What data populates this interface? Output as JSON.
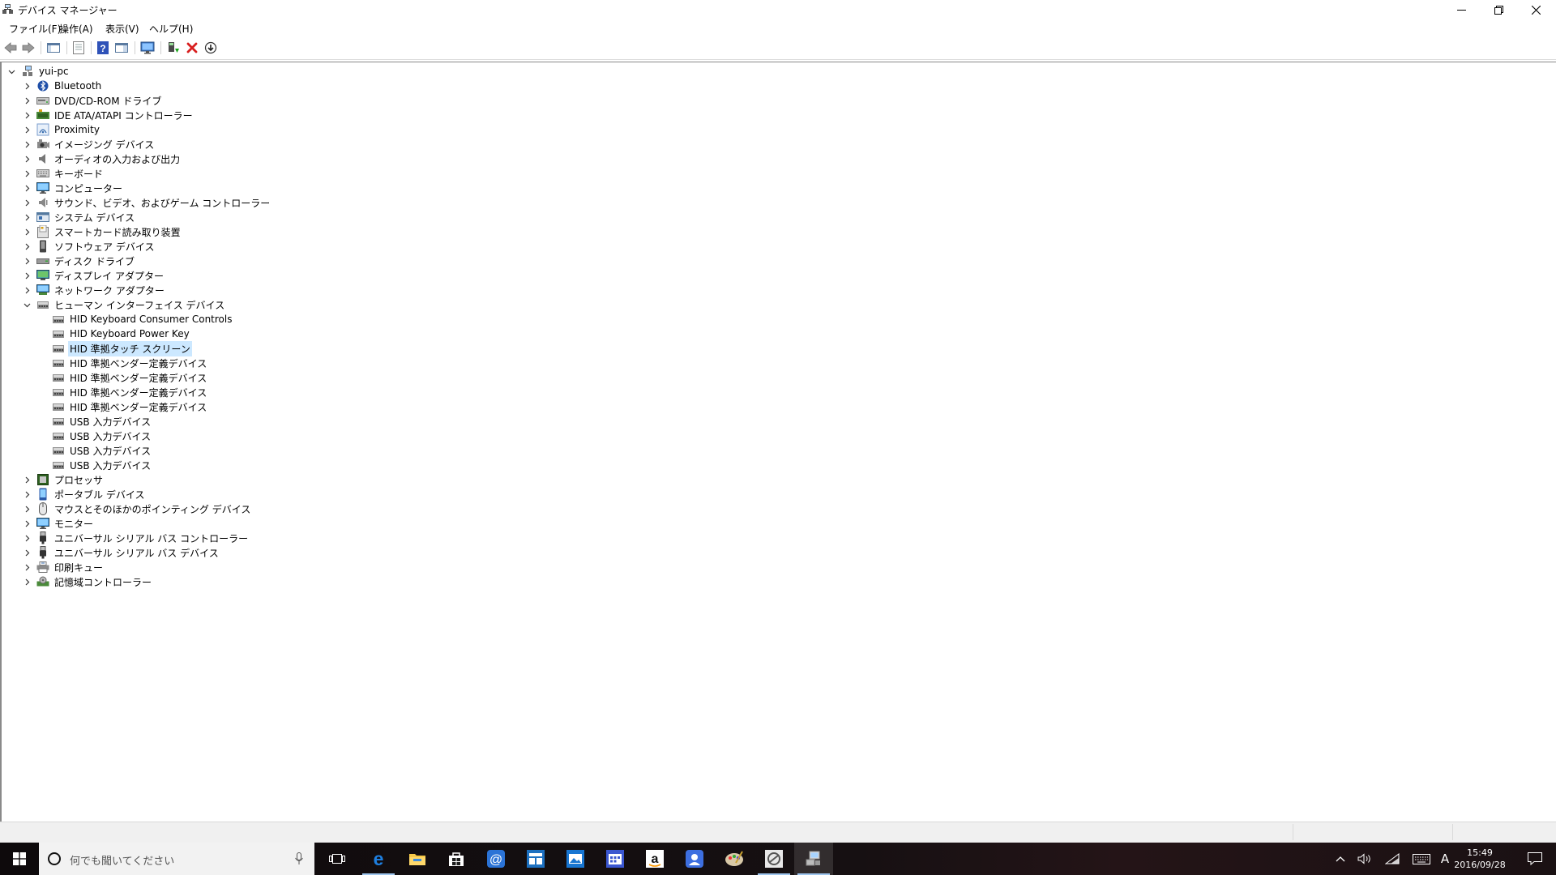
{
  "window": {
    "title": "デバイス マネージャー"
  },
  "menu": [
    {
      "label": "ファイル(F)"
    },
    {
      "label": "操作(A)"
    },
    {
      "label": "表示(V)"
    },
    {
      "label": "ヘルプ(H)"
    }
  ],
  "tree": {
    "root": "yui-pc",
    "categories": [
      {
        "label": "Bluetooth",
        "icon": "bluetooth-icon"
      },
      {
        "label": "DVD/CD-ROM ドライブ",
        "icon": "dvd-drive-icon"
      },
      {
        "label": "IDE ATA/ATAPI コントローラー",
        "icon": "ide-controller-icon"
      },
      {
        "label": "Proximity",
        "icon": "proximity-icon"
      },
      {
        "label": "イメージング デバイス",
        "icon": "camera-icon"
      },
      {
        "label": "オーディオの入力および出力",
        "icon": "speaker-icon"
      },
      {
        "label": "キーボード",
        "icon": "keyboard-icon"
      },
      {
        "label": "コンピューター",
        "icon": "computer-icon"
      },
      {
        "label": "サウンド、ビデオ、およびゲーム コントローラー",
        "icon": "sound-icon"
      },
      {
        "label": "システム デバイス",
        "icon": "system-device-icon"
      },
      {
        "label": "スマートカード読み取り装置",
        "icon": "smartcard-reader-icon"
      },
      {
        "label": "ソフトウェア デバイス",
        "icon": "software-device-icon"
      },
      {
        "label": "ディスク ドライブ",
        "icon": "disk-drive-icon"
      },
      {
        "label": "ディスプレイ アダプター",
        "icon": "display-adapter-icon"
      },
      {
        "label": "ネットワーク アダプター",
        "icon": "network-adapter-icon"
      }
    ],
    "hid": {
      "label": "ヒューマン インターフェイス デバイス",
      "children": [
        {
          "label": "HID Keyboard Consumer Controls"
        },
        {
          "label": "HID Keyboard Power Key"
        },
        {
          "label": "HID 準拠タッチ スクリーン"
        },
        {
          "label": "HID 準拠ベンダー定義デバイス"
        },
        {
          "label": "HID 準拠ベンダー定義デバイス"
        },
        {
          "label": "HID 準拠ベンダー定義デバイス"
        },
        {
          "label": "HID 準拠ベンダー定義デバイス"
        },
        {
          "label": "USB 入力デバイス"
        },
        {
          "label": "USB 入力デバイス"
        },
        {
          "label": "USB 入力デバイス"
        },
        {
          "label": "USB 入力デバイス"
        }
      ],
      "selected_child": "HID 準拠タッチ スクリーン"
    },
    "categories_after": [
      {
        "label": "プロセッサ",
        "icon": "processor-icon"
      },
      {
        "label": "ポータブル デバイス",
        "icon": "portable-device-icon"
      },
      {
        "label": "マウスとそのほかのポインティング デバイス",
        "icon": "mouse-icon"
      },
      {
        "label": "モニター",
        "icon": "monitor-icon"
      },
      {
        "label": "ユニバーサル シリアル バス コントローラー",
        "icon": "usb-icon"
      },
      {
        "label": "ユニバーサル シリアル バス デバイス",
        "icon": "usb-icon"
      },
      {
        "label": "印刷キュー",
        "icon": "printer-icon"
      },
      {
        "label": "記憶域コントローラー",
        "icon": "storage-controller-icon"
      }
    ]
  },
  "taskbar": {
    "search_placeholder": "何でも聞いてください",
    "apps": [
      "edge-icon",
      "file-explorer-icon",
      "store-icon",
      "mail-icon",
      "office-icon",
      "photos-icon",
      "calendar-icon",
      "amazon-icon",
      "teams-icon",
      "paint-icon",
      "snipping-icon",
      "device-manager-icon"
    ],
    "ime_indicator": "A",
    "time": "15:49",
    "date": "2016/09/28"
  },
  "colors": {
    "selection": "#cce8ff",
    "taskbar_active": "#9fc6ee"
  }
}
